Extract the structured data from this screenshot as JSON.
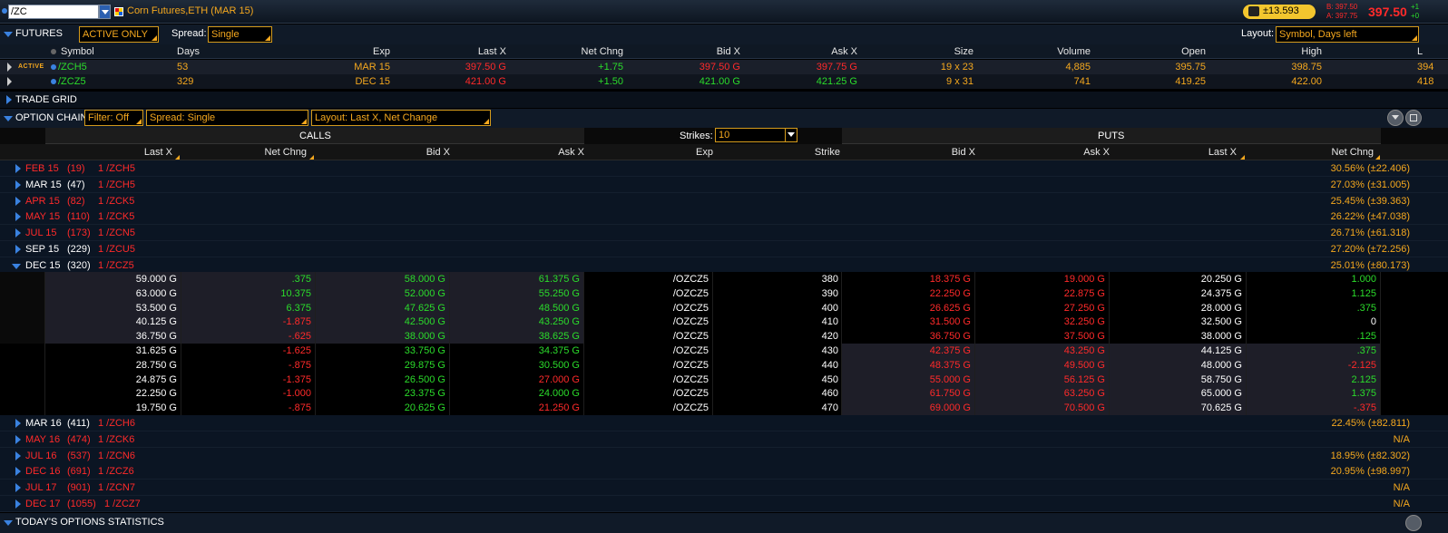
{
  "top": {
    "symbol_value": "/ZC",
    "description": "Corn Futures,ETH (MAR 15)",
    "bp_label": "±13.593",
    "bid_line": "B: 397.50",
    "ask_line": "A: 397.75",
    "last_price": "397.50",
    "chg_line1": "+1",
    "chg_line2": "+0"
  },
  "futures": {
    "title": "FUTURES",
    "filter_value": "ACTIVE ONLY",
    "spread_label": "Spread:",
    "spread_value": "Single",
    "layout_label": "Layout:",
    "layout_value": "Symbol, Days left",
    "columns": [
      "Symbol",
      "Days",
      "Exp",
      "Last X",
      "Net Chng",
      "Bid X",
      "Ask X",
      "Size",
      "Volume",
      "Open",
      "High",
      "L"
    ],
    "rows": [
      {
        "badge": "ACTIVE",
        "symbol": "/ZCH5",
        "days": "53",
        "exp": "MAR 15",
        "last": "397.50 G",
        "net": "+1.75",
        "bid": "397.50 G",
        "ask": "397.75 G",
        "size": "19 x 23",
        "volume": "4,885",
        "open": "395.75",
        "high": "398.75",
        "low": "394"
      },
      {
        "badge": "",
        "symbol": "/ZCZ5",
        "days": "329",
        "exp": "DEC 15",
        "last": "421.00 G",
        "net": "+1.50",
        "bid": "421.00 G",
        "ask": "421.25 G",
        "size": "9 x 31",
        "volume": "741",
        "open": "419.25",
        "high": "422.00",
        "low": "418"
      }
    ]
  },
  "trade_grid": {
    "title": "TRADE GRID"
  },
  "option_chain": {
    "title": "OPTION CHAIN",
    "filter_value": "Filter: Off",
    "spread_value": "Spread: Single",
    "layout_value": "Layout: Last X, Net Change",
    "calls_label": "CALLS",
    "puts_label": "PUTS",
    "strikes_label": "Strikes:",
    "strikes_value": "10",
    "columns": [
      "Last X",
      "Net Chng",
      "Bid X",
      "Ask X",
      "Exp",
      "Strike",
      "Bid X",
      "Ask X",
      "Last X",
      "Net Chng"
    ],
    "expirations_top": [
      {
        "month": "FEB 15",
        "days": "(19)",
        "under": "1 /ZCH5",
        "iv": "30.56% (±22.406)",
        "month_color": "red"
      },
      {
        "month": "MAR 15",
        "days": "(47)",
        "under": "1 /ZCH5",
        "iv": "27.03% (±31.005)",
        "month_color": "white"
      },
      {
        "month": "APR 15",
        "days": "(82)",
        "under": "1 /ZCK5",
        "iv": "25.45% (±39.363)",
        "month_color": "red"
      },
      {
        "month": "MAY 15",
        "days": "(110)",
        "under": "1 /ZCK5",
        "iv": "26.22% (±47.038)",
        "month_color": "red"
      },
      {
        "month": "JUL 15",
        "days": "(173)",
        "under": "1 /ZCN5",
        "iv": "26.71% (±61.318)",
        "month_color": "red"
      },
      {
        "month": "SEP 15",
        "days": "(229)",
        "under": "1 /ZCU5",
        "iv": "27.20% (±72.256)",
        "month_color": "white"
      },
      {
        "month": "DEC 15",
        "days": "(320)",
        "under": "1 /ZCZ5",
        "iv": "25.01% (±80.173)",
        "month_color": "white"
      }
    ],
    "strike_rows": [
      {
        "c_last": "59.000 G",
        "c_net": ".375",
        "c_bid": "58.000 G",
        "c_ask": "61.375 G",
        "exp": "/OZCZ5",
        "strike": "380",
        "p_bid": "18.375 G",
        "p_ask": "19.000 G",
        "p_last": "20.250 G",
        "p_net": "1.000",
        "c_net_color": "green",
        "p_net_color": "green",
        "itm": "call"
      },
      {
        "c_last": "63.000 G",
        "c_net": "10.375",
        "c_bid": "52.000 G",
        "c_ask": "55.250 G",
        "exp": "/OZCZ5",
        "strike": "390",
        "p_bid": "22.250 G",
        "p_ask": "22.875 G",
        "p_last": "24.375 G",
        "p_net": "1.125",
        "c_net_color": "green",
        "p_net_color": "green",
        "itm": "call"
      },
      {
        "c_last": "53.500 G",
        "c_net": "6.375",
        "c_bid": "47.625 G",
        "c_ask": "48.500 G",
        "exp": "/OZCZ5",
        "strike": "400",
        "p_bid": "26.625 G",
        "p_ask": "27.250 G",
        "p_last": "28.000 G",
        "p_net": ".375",
        "c_net_color": "green",
        "p_net_color": "green",
        "itm": "call"
      },
      {
        "c_last": "40.125 G",
        "c_net": "-1.875",
        "c_bid": "42.500 G",
        "c_ask": "43.250 G",
        "exp": "/OZCZ5",
        "strike": "410",
        "p_bid": "31.500 G",
        "p_ask": "32.250 G",
        "p_last": "32.500 G",
        "p_net": "0",
        "c_net_color": "red",
        "p_net_color": "white",
        "itm": "call"
      },
      {
        "c_last": "36.750 G",
        "c_net": "-.625",
        "c_bid": "38.000 G",
        "c_ask": "38.625 G",
        "exp": "/OZCZ5",
        "strike": "420",
        "p_bid": "36.750 G",
        "p_ask": "37.500 G",
        "p_last": "38.000 G",
        "p_net": ".125",
        "c_net_color": "red",
        "p_net_color": "green",
        "itm": "call"
      },
      {
        "c_last": "31.625 G",
        "c_net": "-1.625",
        "c_bid": "33.750 G",
        "c_ask": "34.375 G",
        "exp": "/OZCZ5",
        "strike": "430",
        "p_bid": "42.375 G",
        "p_ask": "43.250 G",
        "p_last": "44.125 G",
        "p_net": ".375",
        "c_net_color": "red",
        "p_net_color": "green",
        "itm": "put"
      },
      {
        "c_last": "28.750 G",
        "c_net": "-.875",
        "c_bid": "29.875 G",
        "c_ask": "30.500 G",
        "exp": "/OZCZ5",
        "strike": "440",
        "p_bid": "48.375 G",
        "p_ask": "49.500 G",
        "p_last": "48.000 G",
        "p_net": "-2.125",
        "c_net_color": "red",
        "p_net_color": "red",
        "itm": "put"
      },
      {
        "c_last": "24.875 G",
        "c_net": "-1.375",
        "c_bid": "26.500 G",
        "c_ask": "27.000 G",
        "exp": "/OZCZ5",
        "strike": "450",
        "p_bid": "55.000 G",
        "p_ask": "56.125 G",
        "p_last": "58.750 G",
        "p_net": "2.125",
        "c_net_color": "red",
        "p_net_color": "green",
        "itm": "put"
      },
      {
        "c_last": "22.250 G",
        "c_net": "-1.000",
        "c_bid": "23.375 G",
        "c_ask": "24.000 G",
        "exp": "/OZCZ5",
        "strike": "460",
        "p_bid": "61.750 G",
        "p_ask": "63.250 G",
        "p_last": "65.000 G",
        "p_net": "1.375",
        "c_net_color": "red",
        "p_net_color": "green",
        "itm": "put"
      },
      {
        "c_last": "19.750 G",
        "c_net": "-.875",
        "c_bid": "20.625 G",
        "c_ask": "21.250 G",
        "exp": "/OZCZ5",
        "strike": "470",
        "p_bid": "69.000 G",
        "p_ask": "70.500 G",
        "p_last": "70.625 G",
        "p_net": "-.375",
        "c_net_color": "red",
        "p_net_color": "red",
        "itm": "put"
      }
    ],
    "expirations_bottom": [
      {
        "month": "MAR 16",
        "days": "(411)",
        "under": "1 /ZCH6",
        "iv": "22.45% (±82.811)",
        "month_color": "white"
      },
      {
        "month": "MAY 16",
        "days": "(474)",
        "under": "1 /ZCK6",
        "iv": "N/A",
        "month_color": "red"
      },
      {
        "month": "JUL 16",
        "days": "(537)",
        "under": "1 /ZCN6",
        "iv": "18.95% (±82.302)",
        "month_color": "red"
      },
      {
        "month": "DEC 16",
        "days": "(691)",
        "under": "1 /ZCZ6",
        "iv": "20.95% (±98.997)",
        "month_color": "red"
      },
      {
        "month": "JUL 17",
        "days": "(901)",
        "under": "1 /ZCN7",
        "iv": "N/A",
        "month_color": "red"
      },
      {
        "month": "DEC 17",
        "days": "(1055)",
        "under": "1 /ZCZ7",
        "iv": "N/A",
        "month_color": "red"
      }
    ]
  },
  "stats": {
    "title": "TODAY'S OPTIONS STATISTICS"
  },
  "colors": {
    "accent_orange": "#f5a81e",
    "up_green": "#2bdc2b",
    "down_red": "#ff2a2a",
    "header_blue": "#0b1a2e",
    "itm_shade": "#1e1e2a"
  }
}
